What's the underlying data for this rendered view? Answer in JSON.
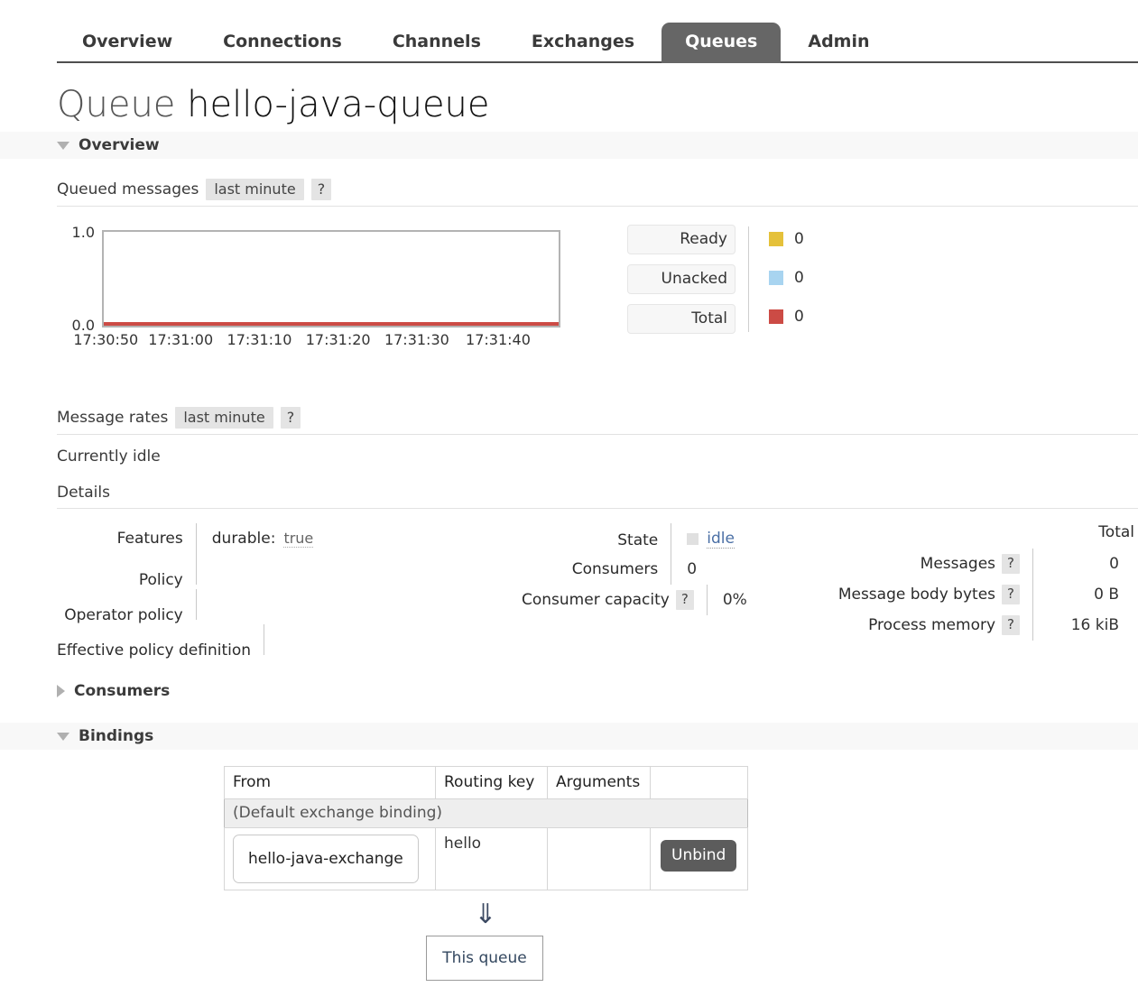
{
  "nav": {
    "tabs": [
      {
        "label": "Overview",
        "active": false
      },
      {
        "label": "Connections",
        "active": false
      },
      {
        "label": "Channels",
        "active": false
      },
      {
        "label": "Exchanges",
        "active": false
      },
      {
        "label": "Queues",
        "active": true
      },
      {
        "label": "Admin",
        "active": false
      }
    ]
  },
  "page": {
    "title_lead": "Queue",
    "queue_name": "hello-java-queue"
  },
  "overview_section": {
    "label": "Overview",
    "caret": "caret-down-icon"
  },
  "queued_messages": {
    "label": "Queued messages",
    "period": "last minute",
    "help": "?"
  },
  "chart_data": {
    "type": "line",
    "title": "Queued messages",
    "xlabel": "",
    "ylabel": "",
    "ylim": [
      0.0,
      1.0
    ],
    "ytick_labels": [
      "1.0",
      "0.0"
    ],
    "x": [
      "17:30:50",
      "17:31:00",
      "17:31:10",
      "17:31:20",
      "17:31:30",
      "17:31:40"
    ],
    "grid": false,
    "legend_position": "right",
    "series": [
      {
        "name": "Ready",
        "color": "#e5c13a",
        "current": "0",
        "values": [
          0,
          0,
          0,
          0,
          0,
          0
        ]
      },
      {
        "name": "Unacked",
        "color": "#a8d4f0",
        "current": "0",
        "values": [
          0,
          0,
          0,
          0,
          0,
          0
        ]
      },
      {
        "name": "Total",
        "color": "#cc4b45",
        "current": "0",
        "values": [
          0,
          0,
          0,
          0,
          0,
          0
        ]
      }
    ]
  },
  "message_rates": {
    "label": "Message rates",
    "period": "last minute",
    "help": "?",
    "status": "Currently idle"
  },
  "details": {
    "label": "Details",
    "col_left": [
      {
        "key": "Features",
        "value_key": "durable:",
        "value": "true",
        "has_value": true
      },
      {
        "key": "Policy",
        "value": "",
        "has_value": false
      },
      {
        "key": "Operator policy",
        "value": "",
        "has_value": false
      },
      {
        "key": "Effective policy definition",
        "value": "",
        "has_value": false
      }
    ],
    "col_mid": [
      {
        "key": "State",
        "value": "idle",
        "swatch": true,
        "help": ""
      },
      {
        "key": "Consumers",
        "value": "0",
        "swatch": false,
        "help": ""
      },
      {
        "key": "Consumer capacity",
        "value": "0%",
        "swatch": false,
        "help": "?"
      }
    ],
    "col_right_header": "Total",
    "col_right": [
      {
        "key": "Messages",
        "help": "?",
        "value": "0"
      },
      {
        "key": "Message body bytes",
        "help": "?",
        "value": "0 B"
      },
      {
        "key": "Process memory",
        "help": "?",
        "value": "16 kiB"
      }
    ]
  },
  "consumers_section": {
    "label": "Consumers",
    "caret": "caret-right-icon"
  },
  "bindings_section": {
    "label": "Bindings",
    "caret": "caret-down-icon",
    "table": {
      "headers": [
        "From",
        "Routing key",
        "Arguments",
        ""
      ],
      "default_row": "(Default exchange binding)",
      "rows": [
        {
          "from": "hello-java-exchange",
          "routing_key": "hello",
          "arguments": "",
          "action": "Unbind"
        }
      ]
    },
    "arrow": "⇓",
    "this_queue": "This queue"
  }
}
